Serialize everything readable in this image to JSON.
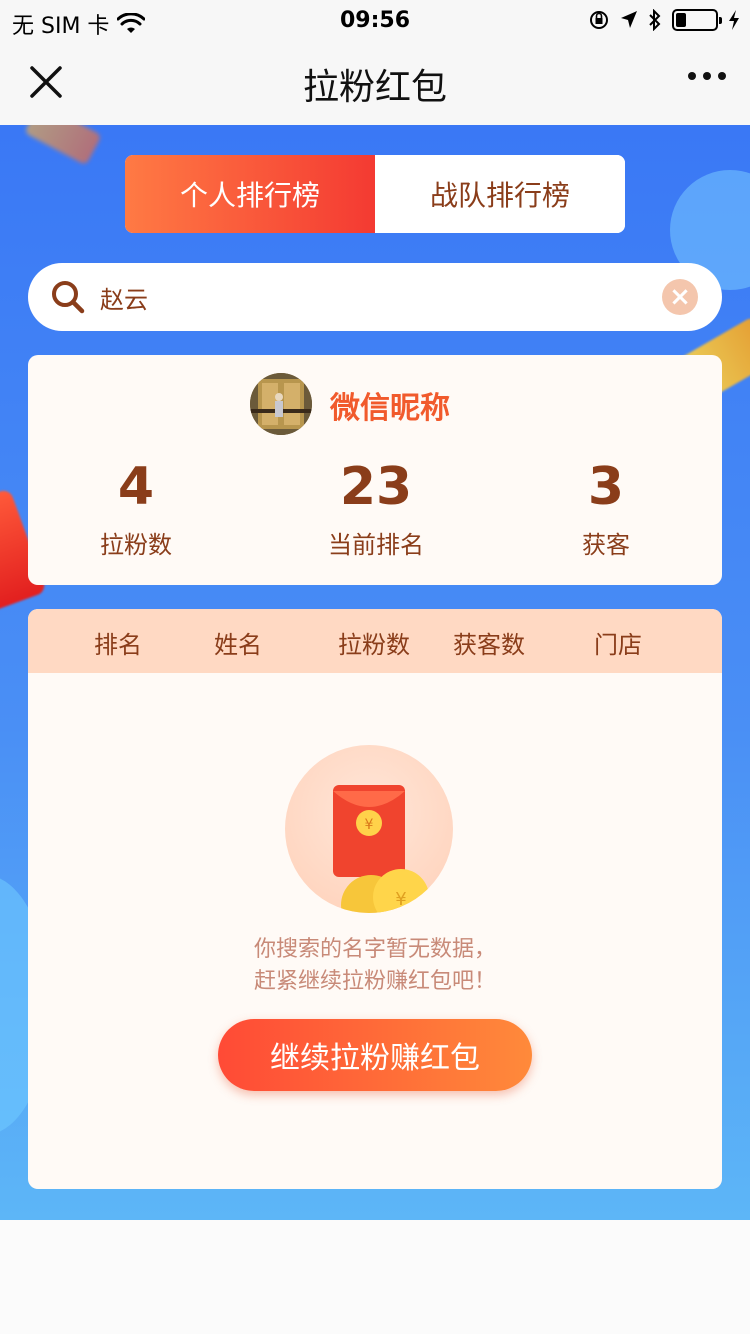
{
  "status_bar": {
    "carrier": "无 SIM 卡",
    "time": "09:56"
  },
  "nav": {
    "title": "拉粉红包"
  },
  "tabs": [
    {
      "label": "个人排行榜",
      "active": true
    },
    {
      "label": "战队排行榜",
      "active": false
    }
  ],
  "search": {
    "value": "赵云"
  },
  "profile": {
    "nickname": "微信昵称",
    "stats": [
      {
        "value": "4",
        "label": "拉粉数"
      },
      {
        "value": "23",
        "label": "当前排名"
      },
      {
        "value": "3",
        "label": "获客"
      }
    ]
  },
  "table": {
    "headers": [
      "排名",
      "姓名",
      "拉粉数",
      "获客数",
      "门店"
    ]
  },
  "empty_state": {
    "line1": "你搜索的名字暂无数据，",
    "line2": "赶紧继续拉粉赚红包吧！",
    "button_label": "继续拉粉赚红包"
  },
  "colors": {
    "accent": "#f43a32",
    "brand_brown": "#8a3d1a",
    "background_blue": "#3a78f5"
  }
}
